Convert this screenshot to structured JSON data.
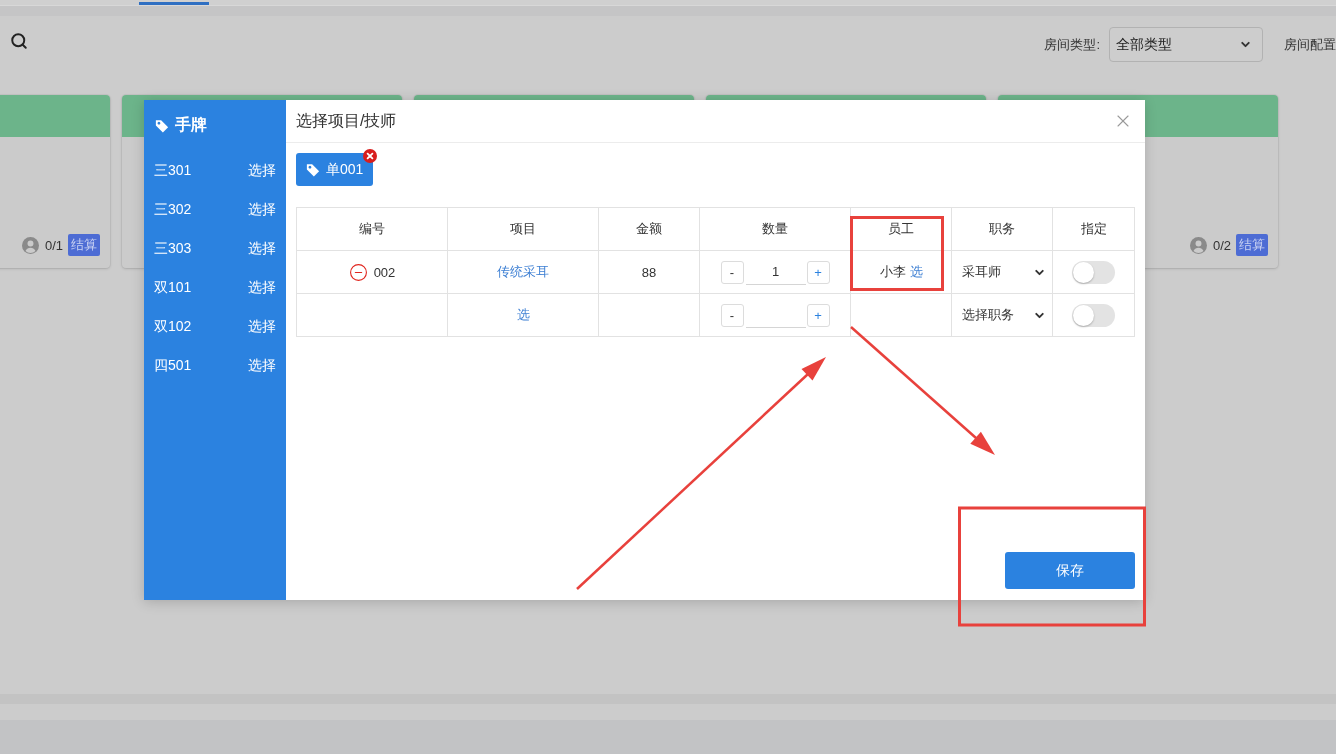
{
  "toolbar": {
    "room_type": {
      "label": "房间类型:",
      "value": "全部类型"
    },
    "room_config": {
      "label": "房间配置"
    }
  },
  "room_cards": [
    {
      "kind": "footer",
      "occupancy": "0/1",
      "action": "结算"
    },
    {
      "kind": "plain"
    },
    {
      "kind": "plain"
    },
    {
      "kind": "plain"
    },
    {
      "kind": "footer",
      "occupancy": "0/2",
      "action": "结算"
    }
  ],
  "modal": {
    "sidebar": {
      "title": "手牌",
      "items": [
        {
          "name": "三301",
          "action": "选择"
        },
        {
          "name": "三302",
          "action": "选择"
        },
        {
          "name": "三303",
          "action": "选择"
        },
        {
          "name": "双101",
          "action": "选择"
        },
        {
          "name": "双102",
          "action": "选择"
        },
        {
          "name": "四501",
          "action": "选择"
        }
      ]
    },
    "title": "选择项目/技师",
    "tags": [
      {
        "label": "单001",
        "removable": true
      }
    ],
    "table": {
      "columns": [
        "编号",
        "项目",
        "金额",
        "数量",
        "员工",
        "职务",
        "指定"
      ],
      "rows": [
        {
          "code": "002",
          "removable": true,
          "item": "传统采耳",
          "amount": "88",
          "decrement": "-",
          "quantity": "1",
          "increment": "+",
          "staff": "小李",
          "staff_action": "选",
          "role": "采耳师",
          "assigned": false
        },
        {
          "removable": false,
          "item": "选",
          "decrement": "-",
          "increment": "+",
          "role": "选择职务",
          "assigned": false
        }
      ]
    },
    "save_button": "保存"
  }
}
